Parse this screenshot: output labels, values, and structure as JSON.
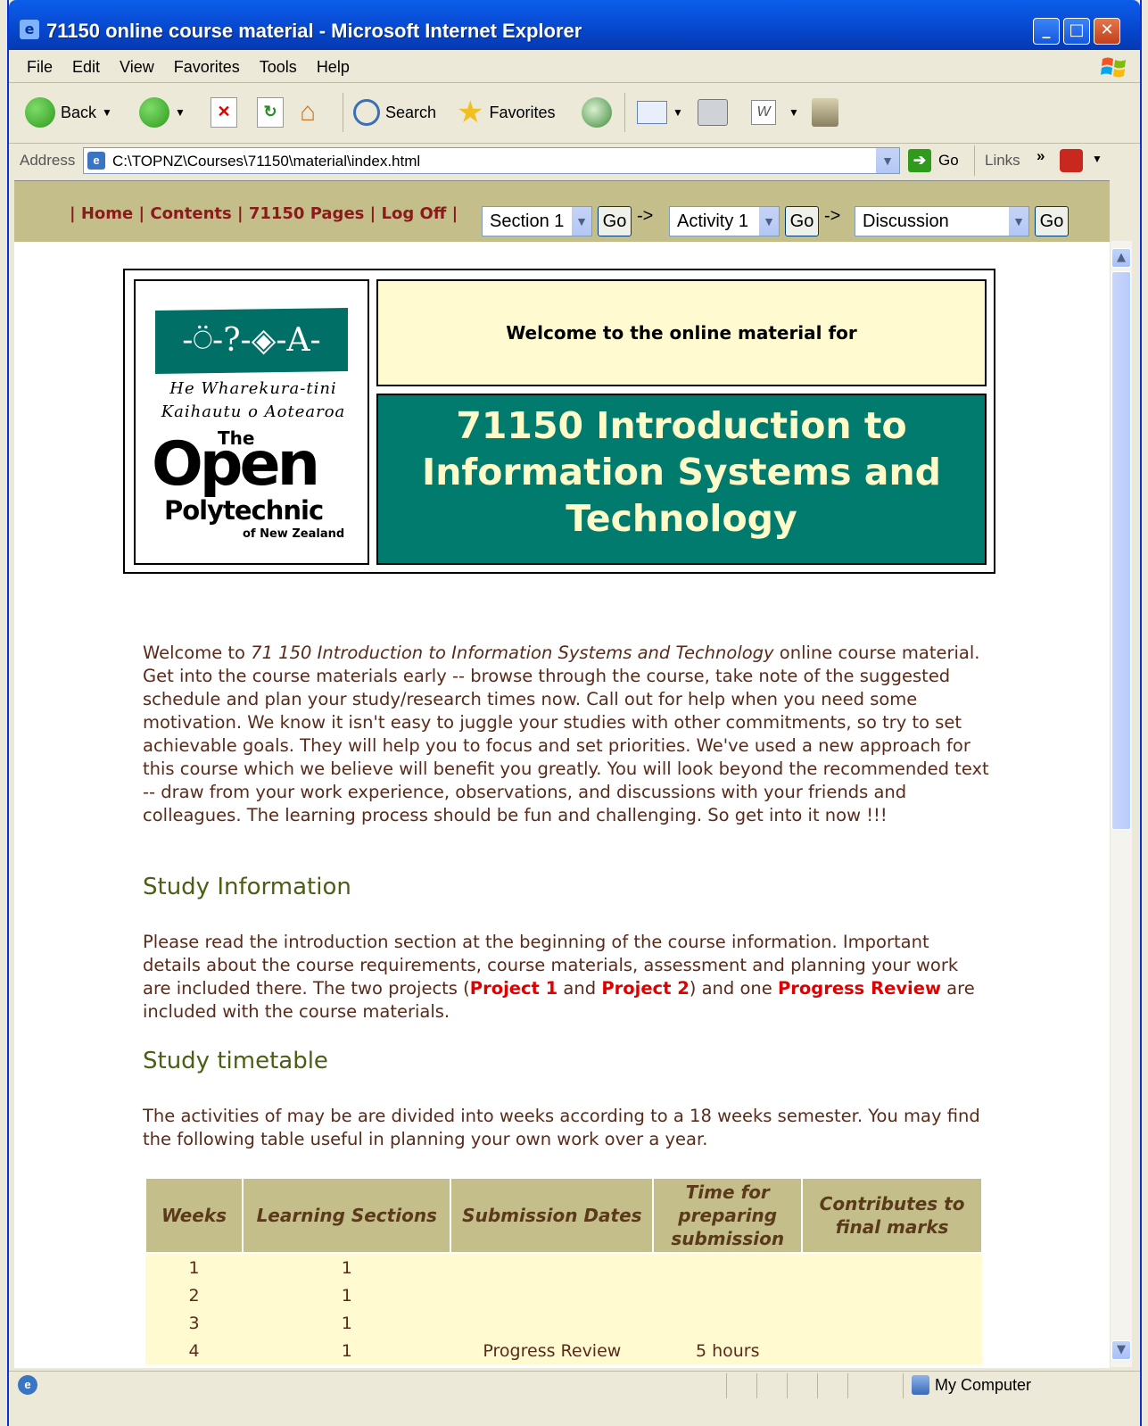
{
  "window": {
    "title": "71150 online course material - Microsoft Internet Explorer",
    "buttons": {
      "minimize": "_",
      "maximize": "□",
      "close": "✕"
    }
  },
  "menu": [
    "File",
    "Edit",
    "View",
    "Favorites",
    "Tools",
    "Help"
  ],
  "toolbar": {
    "back": "Back",
    "search": "Search",
    "favorites": "Favorites"
  },
  "address": {
    "label": "Address",
    "url": "C:\\TOPNZ\\Courses\\71150\\material\\index.html",
    "go": "Go",
    "links": "Links"
  },
  "nav": {
    "links_text": "| Home | Contents | 71150 Pages | Log Off |",
    "home": "Home",
    "contents": "Contents",
    "pages": "71150 Pages",
    "logoff": "Log Off",
    "section_select": "Section 1",
    "activity_select": "Activity 1",
    "discussion_select": "Discussion",
    "go": "Go",
    "arrow": "->"
  },
  "banner": {
    "logo_symbols": "-⍥-?-◈-A-",
    "logo_maori_line1": "He Wharekura-tini",
    "logo_maori_line2": "Kaihautu o Aotearoa",
    "logo_the": "The",
    "logo_open": "Open",
    "logo_polytechnic": "Polytechnic",
    "logo_nz": "of New Zealand",
    "welcome": "Welcome to the online material for",
    "course_title": "71150 Introduction to Information Systems and Technology"
  },
  "intro": {
    "lead": "Welcome to ",
    "course_italic": "71 150 Introduction to Information Systems and Technology",
    "rest": " online course material. Get into the course materials early -- browse through the course, take note of the suggested schedule and plan your study/research times now. Call out for help when you need some motivation. We know it isn't easy to juggle your studies with other commitments, so try to set achievable goals. They will help you to focus and set priorities. We've used a new approach for this course which we believe will benefit you greatly. You will look beyond the recommended text -- draw from your work experience, observations, and discussions with your friends and colleagues. The learning process should be fun and challenging. So get into it now !!!"
  },
  "study_info": {
    "heading": "Study Information",
    "p1": "Please read the introduction section at the beginning of the course information. Important details about the course requirements, course materials, assessment and planning your work are included there. The two projects (",
    "project1": "Project 1",
    "and": " and ",
    "project2": "Project 2",
    "p2": ") and one ",
    "progress_review": "Progress Review",
    "p3": " are included with the course materials."
  },
  "timetable": {
    "heading": "Study timetable",
    "text": "The activities of may be are divided into weeks according to a 18 weeks semester. You may find the following table useful in planning your own work over a year.",
    "headers": [
      "Weeks",
      "Learning Sections",
      "Submission Dates",
      "Time for preparing submission",
      "Contributes to final marks"
    ],
    "rows": [
      [
        "1",
        "1",
        "",
        "",
        ""
      ],
      [
        "2",
        "1",
        "",
        "",
        ""
      ],
      [
        "3",
        "1",
        "",
        "",
        ""
      ],
      [
        "4",
        "1",
        "Progress Review",
        "5 hours",
        ""
      ]
    ]
  },
  "status": {
    "zone": "My Computer"
  }
}
